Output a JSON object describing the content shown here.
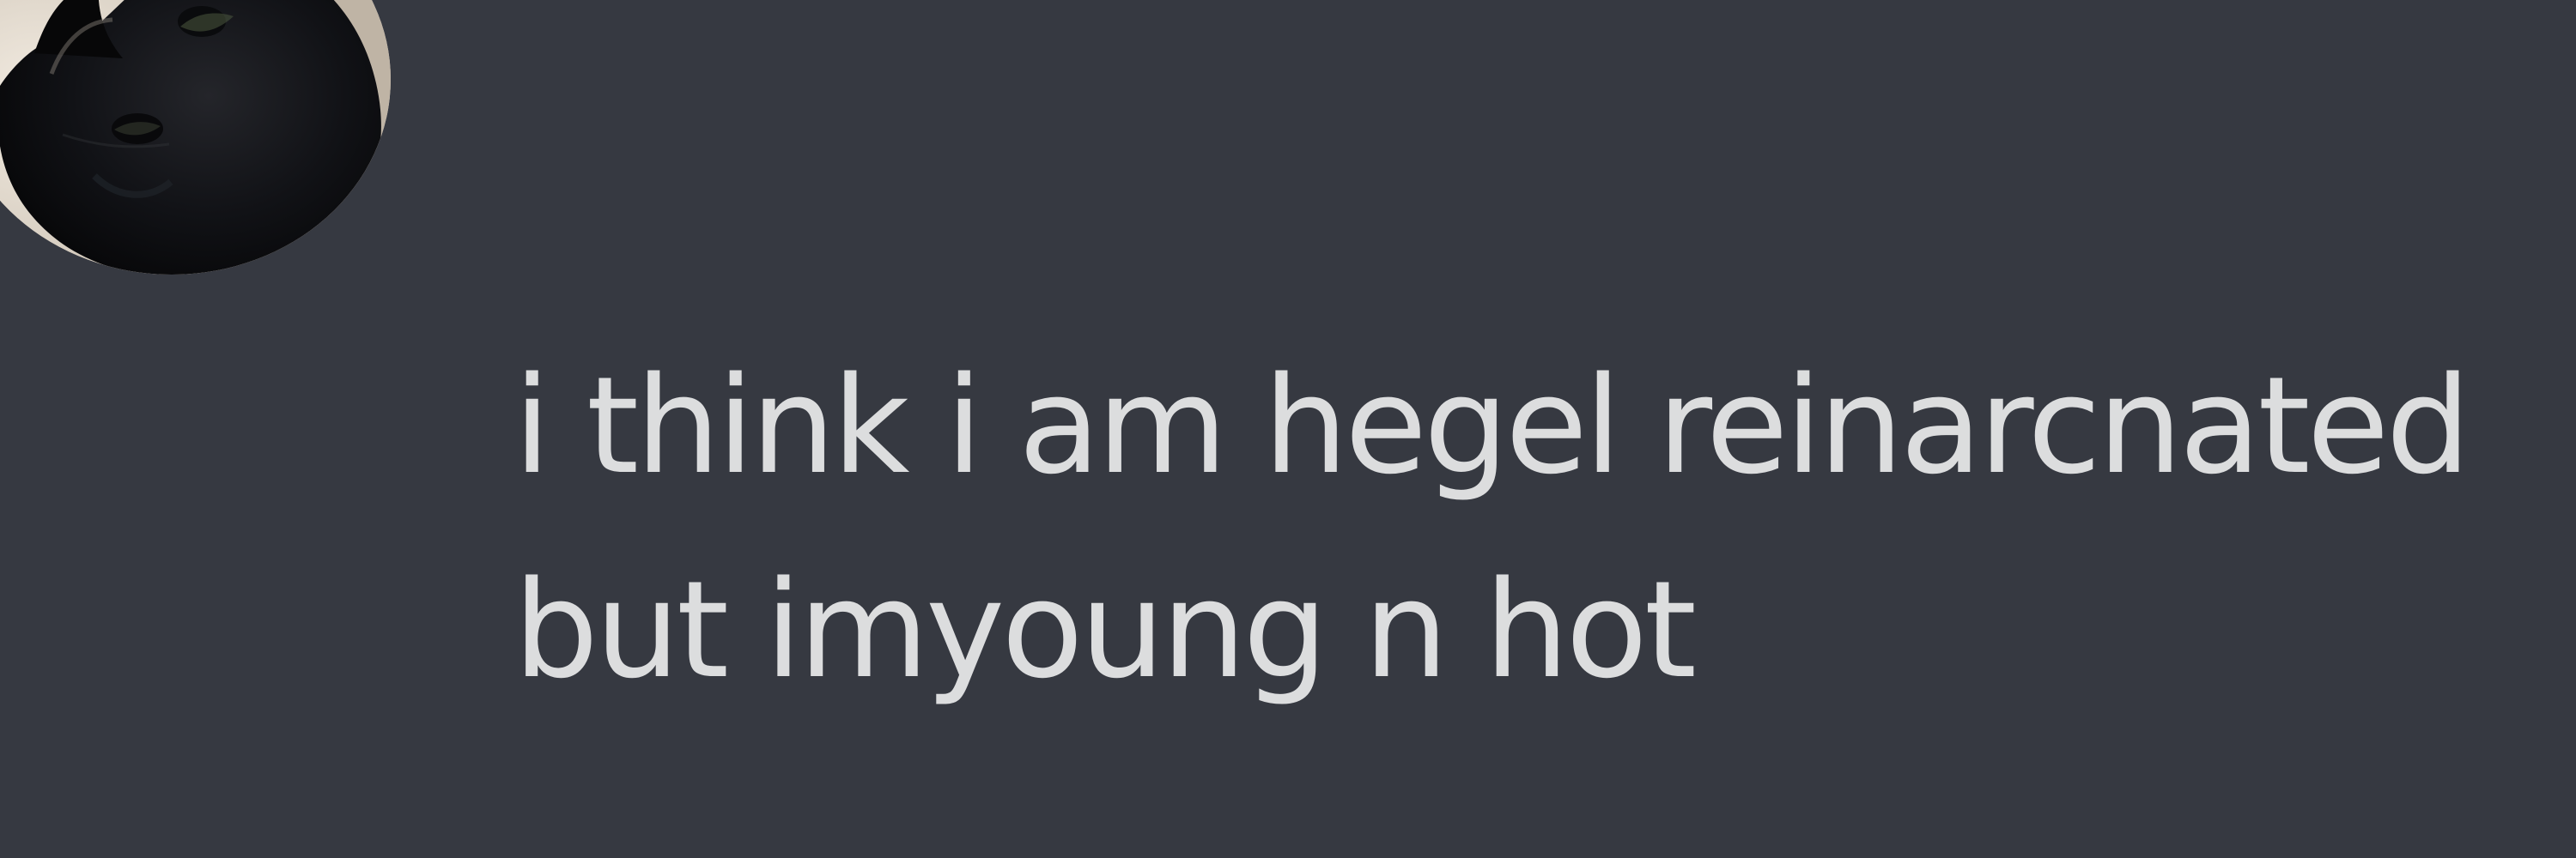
{
  "message": {
    "lines": [
      "i think i am hegel reinarcnated",
      "but imyoung n hot"
    ]
  },
  "colors": {
    "background": "#363941",
    "text": "#dcddde"
  },
  "avatar": {
    "icon": "black-cat-avatar"
  }
}
